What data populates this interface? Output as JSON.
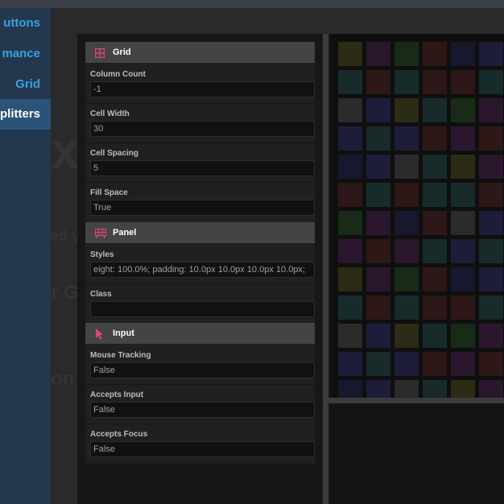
{
  "nav": {
    "items": [
      {
        "label": "uttons",
        "active": false
      },
      {
        "label": "mance",
        "active": false
      },
      {
        "label": "Grid",
        "active": false
      },
      {
        "label": "plitters",
        "active": true
      }
    ]
  },
  "background_text": {
    "heading": "xb",
    "line1": "ed your mi",
    "line2": "r Game",
    "line3": "on"
  },
  "inspector": {
    "sections": [
      {
        "title": "Grid",
        "icon": "grid-icon",
        "properties": [
          {
            "label": "Column Count",
            "value": "-1"
          },
          {
            "label": "Cell Width",
            "value": "30"
          },
          {
            "label": "Cell Spacing",
            "value": "5"
          },
          {
            "label": "Fill Space",
            "value": "True"
          }
        ]
      },
      {
        "title": "Panel",
        "icon": "panel-icon",
        "properties": [
          {
            "label": "Styles",
            "value": "eight: 100.0%; padding: 10.0px 10.0px 10.0px 10.0px;"
          },
          {
            "label": "Class",
            "value": ""
          }
        ]
      },
      {
        "title": "Input",
        "icon": "cursor-icon",
        "properties": [
          {
            "label": "Mouse Tracking",
            "value": "False"
          },
          {
            "label": "Accepts Input",
            "value": "False"
          },
          {
            "label": "Accepts Focus",
            "value": "False"
          }
        ]
      }
    ]
  },
  "colors": {
    "accent": "#e0457b",
    "nav_text": "#3aa0e0",
    "nav_active_bg": "#2b5377",
    "grid_palette": [
      "#2b2b16",
      "#2d1717",
      "#2b2b2b",
      "#2a172d",
      "#17172d",
      "#172b2b",
      "#172b17",
      "#1d1d3a"
    ]
  },
  "grid": {
    "columns": 6,
    "rows": 13
  }
}
